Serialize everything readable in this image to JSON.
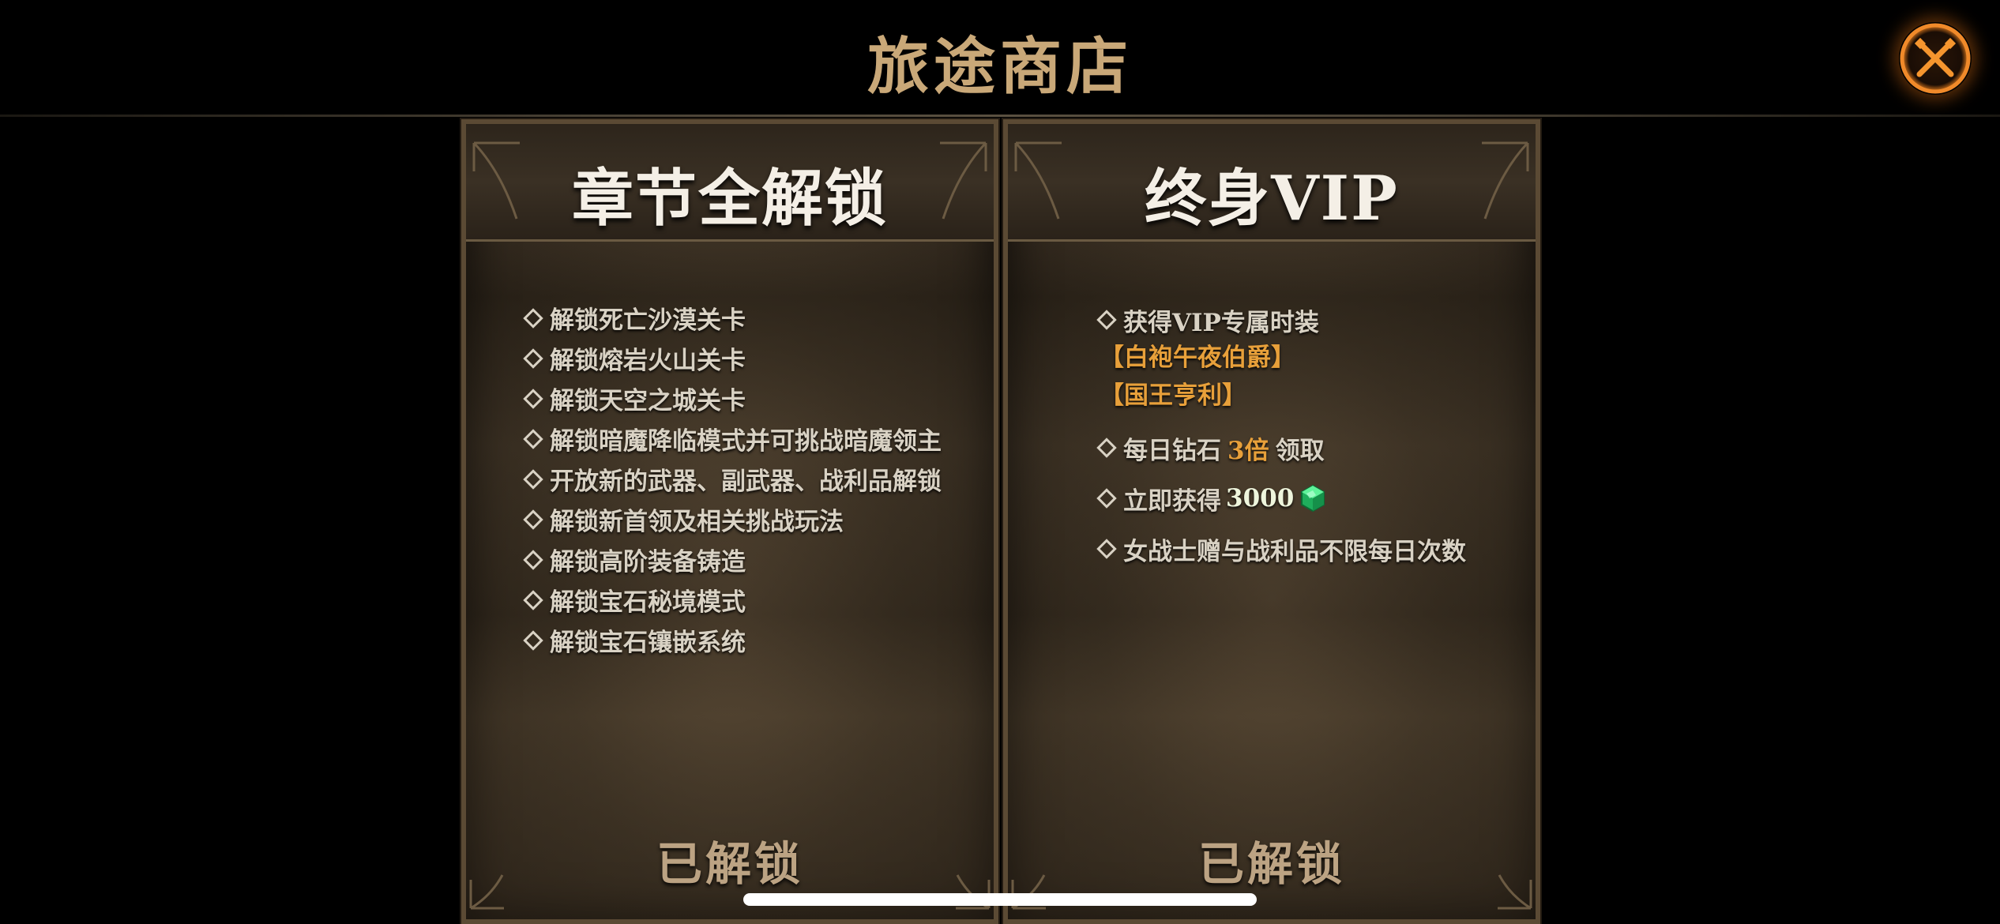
{
  "header": {
    "title": "旅途商店",
    "close_icon": "close-icon"
  },
  "colors": {
    "title_gold": "#c9a878",
    "accent_orange": "#e8a03a",
    "close_glow": "#e06e14",
    "gem_green": "#2ecc71"
  },
  "panels": {
    "chapter": {
      "title": "章节全解锁",
      "features": [
        "解锁死亡沙漠关卡",
        "解锁熔岩火山关卡",
        "解锁天空之城关卡",
        "解锁暗魔降临模式并可挑战暗魔领主",
        "开放新的武器、副武器、战利品解锁",
        "解锁新首领及相关挑战玩法",
        "解锁高阶装备铸造",
        "解锁宝石秘境模式",
        "解锁宝石镶嵌系统"
      ],
      "status": "已解锁"
    },
    "vip": {
      "title": "终身VIP",
      "outfit_label": "获得VIP专属时装",
      "outfits": [
        "【白袍午夜伯爵】",
        "【国王亨利】"
      ],
      "daily_prefix": "每日钻石",
      "daily_multiplier": "3倍",
      "daily_suffix": "领取",
      "instant_prefix": "立即获得",
      "instant_amount": "3000",
      "instant_icon": "gem-icon",
      "unlimited": "女战士赠与战利品不限每日次数",
      "status": "已解锁"
    }
  }
}
